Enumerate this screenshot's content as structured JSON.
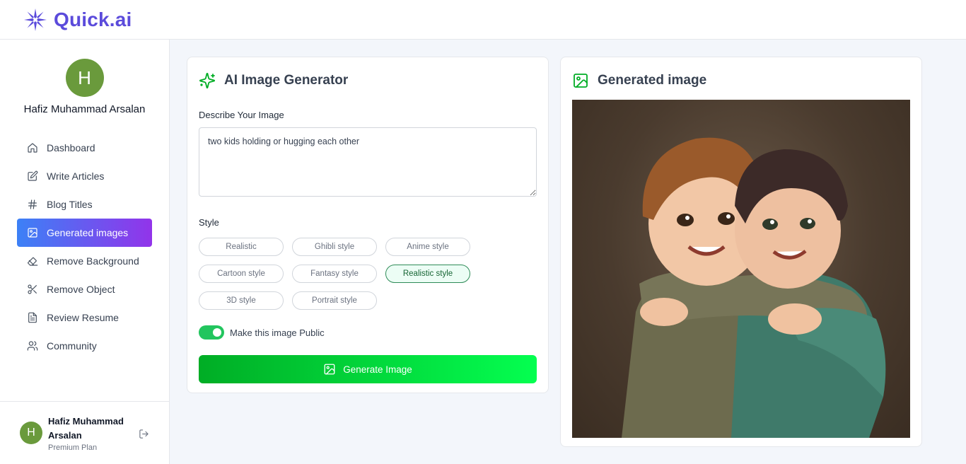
{
  "app": {
    "name": "Quick.ai",
    "brand_color": "#5b4bdb"
  },
  "sidebar": {
    "avatar_initial": "H",
    "user_name": "Hafiz Muhammad Arsalan",
    "items": [
      {
        "label": "Dashboard",
        "icon": "home-icon"
      },
      {
        "label": "Write Articles",
        "icon": "edit-icon"
      },
      {
        "label": "Blog Titles",
        "icon": "hash-icon"
      },
      {
        "label": "Generated images",
        "icon": "image-icon"
      },
      {
        "label": "Remove Background",
        "icon": "eraser-icon"
      },
      {
        "label": "Remove Object",
        "icon": "scissors-icon"
      },
      {
        "label": "Review Resume",
        "icon": "file-text-icon"
      },
      {
        "label": "Community",
        "icon": "users-icon"
      }
    ],
    "footer": {
      "avatar_initial": "H",
      "name": "Hafiz Muhammad Arsalan",
      "plan": "Premium Plan"
    }
  },
  "generator": {
    "title": "AI Image Generator",
    "describe_label": "Describe Your Image",
    "description_value": "two kids holding or hugging each other",
    "style_label": "Style",
    "styles": [
      "Realistic",
      "Ghibli style",
      "Anime style",
      "Cartoon style",
      "Fantasy style",
      "Realistic style",
      "3D style",
      "Portrait style"
    ],
    "selected_style": "Realistic style",
    "public_toggle_label": "Make this image Public",
    "public_toggle_on": true,
    "generate_button": "Generate Image",
    "accent_color": "#00ad25"
  },
  "result": {
    "title": "Generated image"
  }
}
